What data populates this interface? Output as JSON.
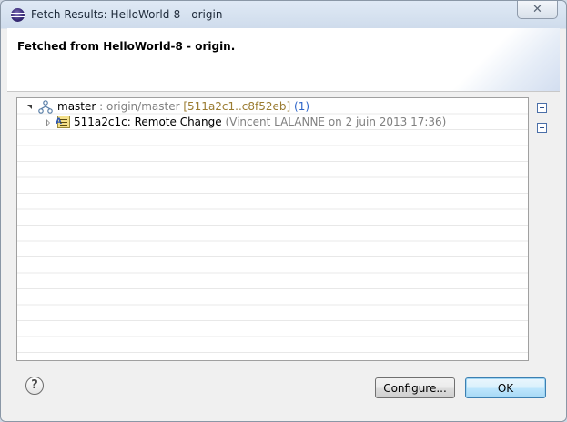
{
  "window": {
    "title": "Fetch Results: HelloWorld-8 - origin",
    "close_glyph": "✕",
    "app_icon": "eclipse-icon"
  },
  "banner": {
    "heading": "Fetched from HelloWorld-8 - origin."
  },
  "tree": {
    "rows": [
      {
        "expanded": true,
        "icon": "branch-icon",
        "name": "master",
        "separator": " : ",
        "remote": "origin/master",
        "range": "[511a2c1..c8f52eb]",
        "count": "(1)"
      },
      {
        "expanded": false,
        "icon": "commit-icon",
        "commit": "511a2c1c: Remote Change",
        "details": "(Vincent LALANNE on 2 juin 2013 17:36)"
      }
    ]
  },
  "side_toolbar": {
    "collapse_icon": "collapse-all-icon",
    "expand_icon": "expand-all-icon"
  },
  "footer": {
    "help_glyph": "?",
    "configure_label": "Configure...",
    "ok_label": "OK"
  },
  "colors": {
    "range_text": "#9a7b30",
    "count_text": "#2c64c8",
    "secondary_text": "#808080",
    "ok_border": "#3c7fb1"
  }
}
